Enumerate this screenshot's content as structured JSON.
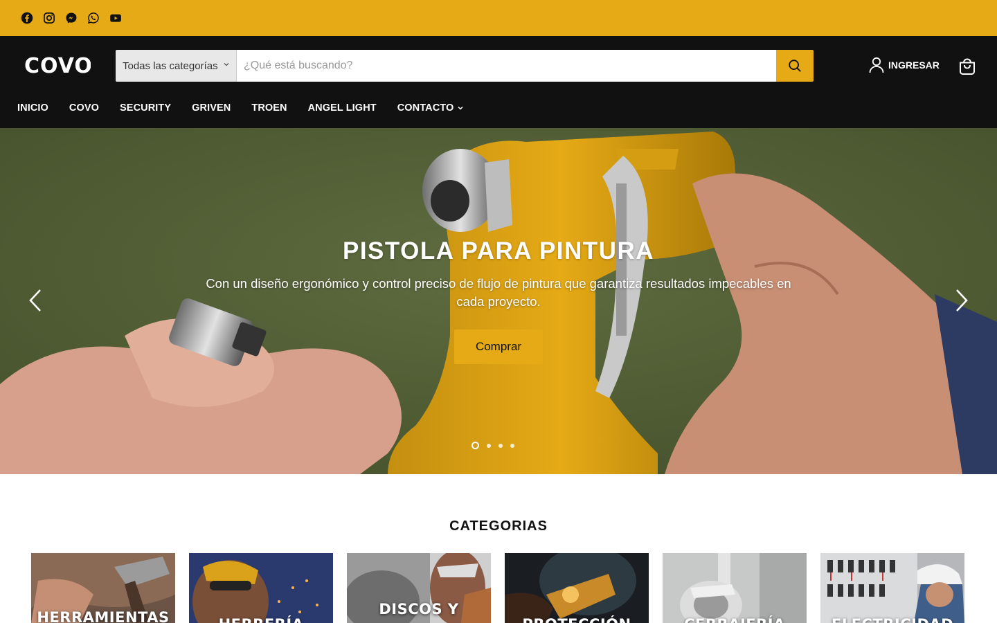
{
  "social": {
    "icons": [
      "facebook-icon",
      "instagram-icon",
      "messenger-icon",
      "whatsapp-icon",
      "youtube-icon"
    ]
  },
  "header": {
    "logo": "COVO",
    "search": {
      "category_label": "Todas las categorías",
      "placeholder": "¿Qué está buscando?"
    },
    "login_label": "INGRESAR"
  },
  "nav": {
    "items": [
      {
        "label": "INICIO"
      },
      {
        "label": "COVO"
      },
      {
        "label": "SECURITY"
      },
      {
        "label": "GRIVEN"
      },
      {
        "label": "TROEN"
      },
      {
        "label": "ANGEL LIGHT"
      },
      {
        "label": "CONTACTO"
      }
    ]
  },
  "hero": {
    "title": "PISTOLA PARA PINTURA",
    "subtitle": "Con un diseño ergonómico y control preciso de flujo de pintura que garantiza resultados impecables en cada proyecto.",
    "button_label": "Comprar",
    "slides_count": 4,
    "active_slide": 1
  },
  "categories": {
    "title": "CATEGORIAS",
    "items": [
      {
        "label": "HERRAMIENTAS"
      },
      {
        "label": "HERRERÍA"
      },
      {
        "label": "DISCOS Y"
      },
      {
        "label": "PROTECCIÓN"
      },
      {
        "label": "CERRAJERÍA"
      },
      {
        "label": "ELECTRICIDAD"
      }
    ]
  },
  "colors": {
    "accent": "#e6aa16",
    "header_bg": "#111111",
    "hero_bg": "#56633a"
  }
}
